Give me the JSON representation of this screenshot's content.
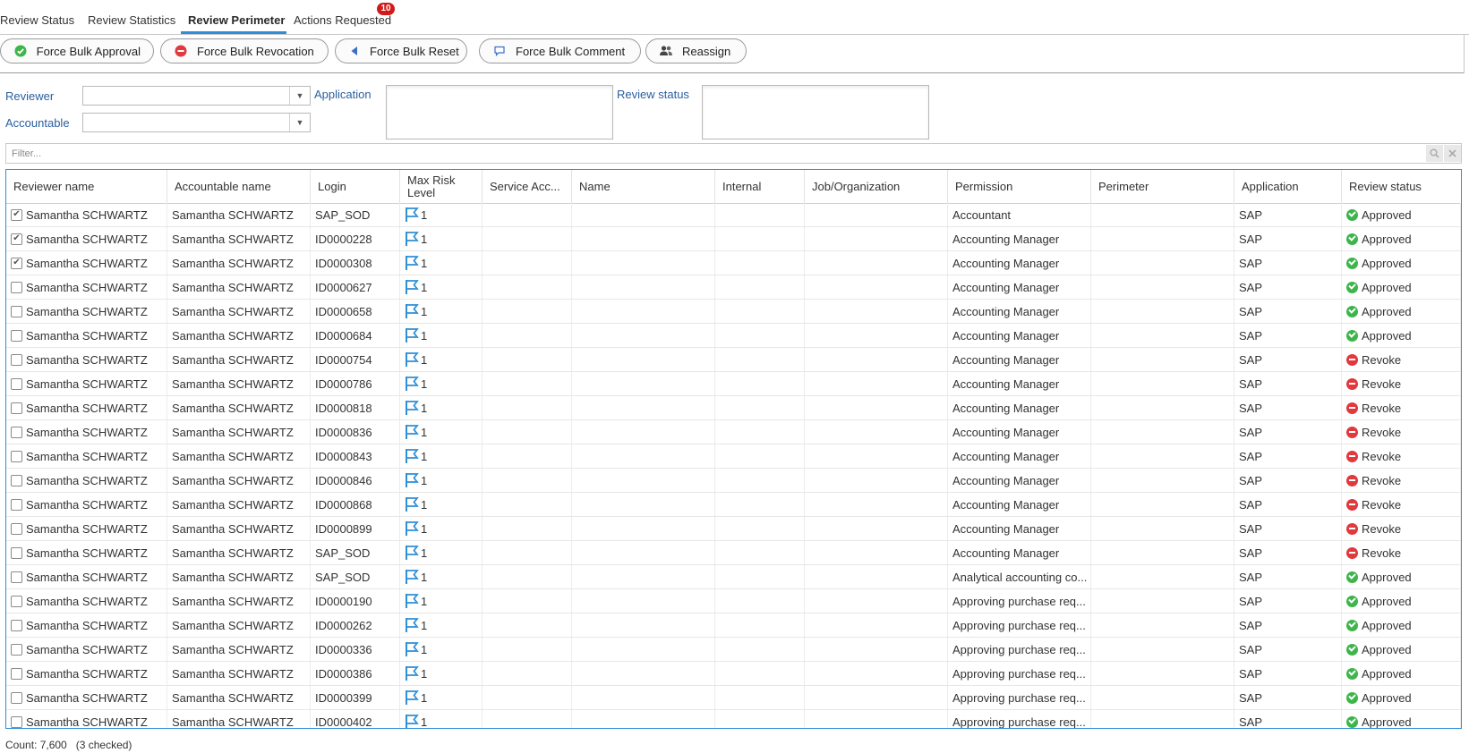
{
  "tabs": [
    {
      "label": "Review Status"
    },
    {
      "label": "Review Statistics"
    },
    {
      "label": "Review Perimeter"
    },
    {
      "label": "Actions Requested"
    }
  ],
  "badge_count": "10",
  "toolbar": {
    "approve_label": "Force Bulk Approval",
    "revoke_label": "Force Bulk Revocation",
    "reset_label": "Force Bulk Reset",
    "comment_label": "Force Bulk Comment",
    "reassign_label": "Reassign"
  },
  "filters": {
    "reviewer_label": "Reviewer",
    "accountable_label": "Accountable",
    "application_label": "Application",
    "review_status_label": "Review status",
    "filter_placeholder": "Filter..."
  },
  "grid": {
    "columns": [
      "Reviewer name",
      "Accountable name",
      "Login",
      "Max Risk Level",
      "Service Acc...",
      "Name",
      "Internal",
      "Job/Organization",
      "Permission",
      "Perimeter",
      "Application",
      "Review status"
    ],
    "rows": [
      {
        "checked": true,
        "reviewer": "Samantha SCHWARTZ",
        "accountable": "Samantha SCHWARTZ",
        "login": "SAP_SOD",
        "risk": "1",
        "permission": "Accountant",
        "application": "SAP",
        "status": "Approved"
      },
      {
        "checked": true,
        "reviewer": "Samantha SCHWARTZ",
        "accountable": "Samantha SCHWARTZ",
        "login": "ID0000228",
        "risk": "1",
        "permission": "Accounting Manager",
        "application": "SAP",
        "status": "Approved"
      },
      {
        "checked": true,
        "reviewer": "Samantha SCHWARTZ",
        "accountable": "Samantha SCHWARTZ",
        "login": "ID0000308",
        "risk": "1",
        "permission": "Accounting Manager",
        "application": "SAP",
        "status": "Approved"
      },
      {
        "checked": false,
        "reviewer": "Samantha SCHWARTZ",
        "accountable": "Samantha SCHWARTZ",
        "login": "ID0000627",
        "risk": "1",
        "permission": "Accounting Manager",
        "application": "SAP",
        "status": "Approved"
      },
      {
        "checked": false,
        "reviewer": "Samantha SCHWARTZ",
        "accountable": "Samantha SCHWARTZ",
        "login": "ID0000658",
        "risk": "1",
        "permission": "Accounting Manager",
        "application": "SAP",
        "status": "Approved"
      },
      {
        "checked": false,
        "reviewer": "Samantha SCHWARTZ",
        "accountable": "Samantha SCHWARTZ",
        "login": "ID0000684",
        "risk": "1",
        "permission": "Accounting Manager",
        "application": "SAP",
        "status": "Approved"
      },
      {
        "checked": false,
        "reviewer": "Samantha SCHWARTZ",
        "accountable": "Samantha SCHWARTZ",
        "login": "ID0000754",
        "risk": "1",
        "permission": "Accounting Manager",
        "application": "SAP",
        "status": "Revoke"
      },
      {
        "checked": false,
        "reviewer": "Samantha SCHWARTZ",
        "accountable": "Samantha SCHWARTZ",
        "login": "ID0000786",
        "risk": "1",
        "permission": "Accounting Manager",
        "application": "SAP",
        "status": "Revoke"
      },
      {
        "checked": false,
        "reviewer": "Samantha SCHWARTZ",
        "accountable": "Samantha SCHWARTZ",
        "login": "ID0000818",
        "risk": "1",
        "permission": "Accounting Manager",
        "application": "SAP",
        "status": "Revoke"
      },
      {
        "checked": false,
        "reviewer": "Samantha SCHWARTZ",
        "accountable": "Samantha SCHWARTZ",
        "login": "ID0000836",
        "risk": "1",
        "permission": "Accounting Manager",
        "application": "SAP",
        "status": "Revoke"
      },
      {
        "checked": false,
        "reviewer": "Samantha SCHWARTZ",
        "accountable": "Samantha SCHWARTZ",
        "login": "ID0000843",
        "risk": "1",
        "permission": "Accounting Manager",
        "application": "SAP",
        "status": "Revoke"
      },
      {
        "checked": false,
        "reviewer": "Samantha SCHWARTZ",
        "accountable": "Samantha SCHWARTZ",
        "login": "ID0000846",
        "risk": "1",
        "permission": "Accounting Manager",
        "application": "SAP",
        "status": "Revoke"
      },
      {
        "checked": false,
        "reviewer": "Samantha SCHWARTZ",
        "accountable": "Samantha SCHWARTZ",
        "login": "ID0000868",
        "risk": "1",
        "permission": "Accounting Manager",
        "application": "SAP",
        "status": "Revoke"
      },
      {
        "checked": false,
        "reviewer": "Samantha SCHWARTZ",
        "accountable": "Samantha SCHWARTZ",
        "login": "ID0000899",
        "risk": "1",
        "permission": "Accounting Manager",
        "application": "SAP",
        "status": "Revoke"
      },
      {
        "checked": false,
        "reviewer": "Samantha SCHWARTZ",
        "accountable": "Samantha SCHWARTZ",
        "login": "SAP_SOD",
        "risk": "1",
        "permission": "Accounting Manager",
        "application": "SAP",
        "status": "Revoke"
      },
      {
        "checked": false,
        "reviewer": "Samantha SCHWARTZ",
        "accountable": "Samantha SCHWARTZ",
        "login": "SAP_SOD",
        "risk": "1",
        "permission": "Analytical accounting co...",
        "application": "SAP",
        "status": "Approved"
      },
      {
        "checked": false,
        "reviewer": "Samantha SCHWARTZ",
        "accountable": "Samantha SCHWARTZ",
        "login": "ID0000190",
        "risk": "1",
        "permission": "Approving purchase req...",
        "application": "SAP",
        "status": "Approved"
      },
      {
        "checked": false,
        "reviewer": "Samantha SCHWARTZ",
        "accountable": "Samantha SCHWARTZ",
        "login": "ID0000262",
        "risk": "1",
        "permission": "Approving purchase req...",
        "application": "SAP",
        "status": "Approved"
      },
      {
        "checked": false,
        "reviewer": "Samantha SCHWARTZ",
        "accountable": "Samantha SCHWARTZ",
        "login": "ID0000336",
        "risk": "1",
        "permission": "Approving purchase req...",
        "application": "SAP",
        "status": "Approved"
      },
      {
        "checked": false,
        "reviewer": "Samantha SCHWARTZ",
        "accountable": "Samantha SCHWARTZ",
        "login": "ID0000386",
        "risk": "1",
        "permission": "Approving purchase req...",
        "application": "SAP",
        "status": "Approved"
      },
      {
        "checked": false,
        "reviewer": "Samantha SCHWARTZ",
        "accountable": "Samantha SCHWARTZ",
        "login": "ID0000399",
        "risk": "1",
        "permission": "Approving purchase req...",
        "application": "SAP",
        "status": "Approved"
      },
      {
        "checked": false,
        "reviewer": "Samantha SCHWARTZ",
        "accountable": "Samantha SCHWARTZ",
        "login": "ID0000402",
        "risk": "1",
        "permission": "Approving purchase req...",
        "application": "SAP",
        "status": "Approved"
      }
    ]
  },
  "footer": {
    "count_text": "Count: 7,600",
    "checked_text": "(3 checked)"
  },
  "colors": {
    "accent": "#2f8fd6",
    "approved": "#3db54a",
    "revoke": "#e0393e",
    "label": "#2b5f9e",
    "badge": "#d11a1a"
  },
  "icons": {
    "approve": "check-circle-icon",
    "revoke": "minus-circle-icon",
    "reset": "left-triangle-icon",
    "comment": "speech-bubble-icon",
    "reassign": "users-icon",
    "risk": "flag-icon"
  }
}
